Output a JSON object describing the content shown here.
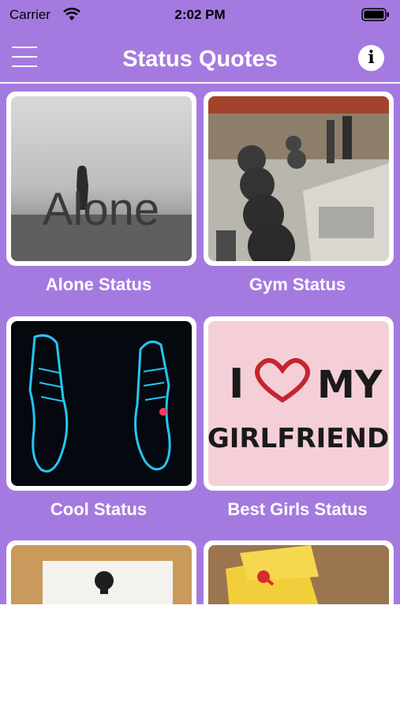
{
  "status_bar": {
    "carrier": "Carrier",
    "time": "2:02 PM"
  },
  "nav": {
    "title": "Status Quotes",
    "info_glyph": "i"
  },
  "colors": {
    "background": "#a57ae0",
    "card": "#ffffff",
    "text": "#ffffff"
  },
  "categories": [
    {
      "label": "Alone Status",
      "thumb_text": "Alone"
    },
    {
      "label": "Gym Status"
    },
    {
      "label": "Cool Status"
    },
    {
      "label": "Best Girls Status",
      "thumb_text_1": "I",
      "thumb_text_2": "MY",
      "thumb_text_3": "GIRLFRIEND"
    },
    {
      "label": ""
    },
    {
      "label": ""
    }
  ]
}
